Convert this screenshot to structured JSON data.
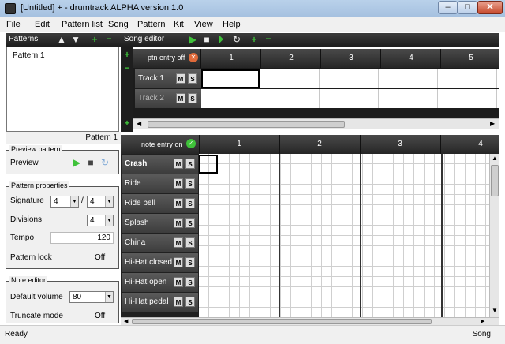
{
  "window": {
    "title": "[Untitled] + - drumtrack ALPHA version 1.0",
    "minimize": "–",
    "maximize": "□",
    "close": "✕"
  },
  "menu": [
    "File",
    "Edit",
    "Pattern list",
    "Song",
    "Pattern",
    "Kit",
    "View",
    "Help"
  ],
  "patterns_panel": {
    "title": "Patterns",
    "items": [
      "Pattern 1"
    ],
    "current": "Pattern 1"
  },
  "song_editor": {
    "title": "Song editor",
    "entry_label": "ptn entry off",
    "bars": [
      "1",
      "2",
      "3",
      "4",
      "5"
    ],
    "tracks": [
      {
        "name": "Track 1"
      },
      {
        "name": "Track 2"
      }
    ],
    "mute": "M",
    "solo": "S",
    "add": "+",
    "remove": "−"
  },
  "preview_pattern": {
    "legend": "Preview pattern",
    "label": "Preview"
  },
  "pattern_properties": {
    "legend": "Pattern properties",
    "signature_label": "Signature",
    "signature_num": "4",
    "signature_sep": "/",
    "signature_den": "4",
    "divisions_label": "Divisions",
    "divisions": "4",
    "tempo_label": "Tempo",
    "tempo": "120",
    "lock_label": "Pattern lock",
    "lock_value": "Off"
  },
  "note_editor_props": {
    "legend": "Note editor",
    "volume_label": "Default volume",
    "volume": "80",
    "truncate_label": "Truncate mode",
    "truncate_value": "Off"
  },
  "note_editor": {
    "entry_label": "note entry on",
    "bars": [
      "1",
      "2",
      "3",
      "4"
    ],
    "instruments": [
      "Crash",
      "Ride",
      "Ride bell",
      "Splash",
      "China",
      "Hi-Hat closed",
      "Hi-Hat open",
      "Hi-Hat pedal"
    ],
    "mute": "M",
    "solo": "S"
  },
  "status": {
    "left": "Ready.",
    "right": "Song"
  },
  "colors": {
    "accent_green": "#3fc23a",
    "dark_panel": "#2a2a2a",
    "title_blue": "#b9d1ea"
  }
}
